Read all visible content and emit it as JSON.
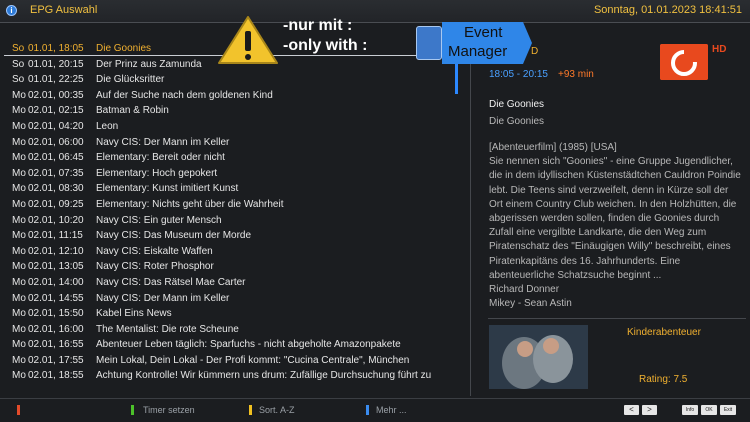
{
  "header": {
    "title": "EPG Auswahl",
    "datetime": "Sonntag, 01.01.2023  18:41:51"
  },
  "overlay": {
    "warning_line1": "-nur mit :",
    "warning_line2": "-only with :",
    "event_badge_1": "Event",
    "event_badge_2": "Manager"
  },
  "events": [
    {
      "day": "So",
      "datetime": "01.01, 18:05",
      "title": "Die Goonies"
    },
    {
      "day": "So",
      "datetime": "01.01, 20:15",
      "title": "Der Prinz aus Zamunda"
    },
    {
      "day": "So",
      "datetime": "01.01, 22:25",
      "title": "Die Glücksritter"
    },
    {
      "day": "Mo",
      "datetime": "02.01, 00:35",
      "title": "Auf der Suche nach dem goldenen Kind"
    },
    {
      "day": "Mo",
      "datetime": "02.01, 02:15",
      "title": "Batman & Robin"
    },
    {
      "day": "Mo",
      "datetime": "02.01, 04:20",
      "title": "Leon"
    },
    {
      "day": "Mo",
      "datetime": "02.01, 06:00",
      "title": "Navy CIS: Der Mann im Keller"
    },
    {
      "day": "Mo",
      "datetime": "02.01, 06:45",
      "title": "Elementary: Bereit oder nicht"
    },
    {
      "day": "Mo",
      "datetime": "02.01, 07:35",
      "title": "Elementary: Hoch gepokert"
    },
    {
      "day": "Mo",
      "datetime": "02.01, 08:30",
      "title": "Elementary: Kunst imitiert Kunst"
    },
    {
      "day": "Mo",
      "datetime": "02.01, 09:25",
      "title": "Elementary: Nichts geht über die Wahrheit"
    },
    {
      "day": "Mo",
      "datetime": "02.01, 10:20",
      "title": "Navy CIS: Ein guter Mensch"
    },
    {
      "day": "Mo",
      "datetime": "02.01, 11:15",
      "title": "Navy CIS: Das Museum der Morde"
    },
    {
      "day": "Mo",
      "datetime": "02.01, 12:10",
      "title": "Navy CIS: Eiskalte Waffen"
    },
    {
      "day": "Mo",
      "datetime": "02.01, 13:05",
      "title": "Navy CIS: Roter Phosphor"
    },
    {
      "day": "Mo",
      "datetime": "02.01, 14:00",
      "title": "Navy CIS: Das Rätsel Mae Carter"
    },
    {
      "day": "Mo",
      "datetime": "02.01, 14:55",
      "title": "Navy CIS: Der Mann im Keller"
    },
    {
      "day": "Mo",
      "datetime": "02.01, 15:50",
      "title": "Kabel Eins News"
    },
    {
      "day": "Mo",
      "datetime": "02.01, 16:00",
      "title": "The Mentalist: Die rote Scheune"
    },
    {
      "day": "Mo",
      "datetime": "02.01, 16:55",
      "title": "Abenteuer Leben täglich: Sparfuchs - nicht abgeholte Amazonpakete"
    },
    {
      "day": "Mo",
      "datetime": "02.01, 17:55",
      "title": "Mein Lokal, Dein Lokal - Der Profi kommt: \"Cucina Centrale\", München"
    },
    {
      "day": "Mo",
      "datetime": "02.01, 18:55",
      "title": "Achtung Kontrolle! Wir kümmern uns drum: Zufällige Durchsuchung führt zu"
    }
  ],
  "details": {
    "letter": "D",
    "time_range": "18:05 - 20:15",
    "duration": "+93 min",
    "channel_hd": "HD",
    "title": "Die Goonies",
    "subtitle": "Die Goonies",
    "meta": "[Abenteuerfilm]  (1985) [USA]",
    "description": "Sie nennen sich \"Goonies\" - eine Gruppe Jugendlicher, die in dem idyllischen Küstenstädtchen Cauldron Poindie lebt. Die Teens sind verzweifelt, denn in Kürze soll der Ort einem Country Club weichen. In den Holzhütten, die abgerissen werden sollen, finden die Goonies durch Zufall eine vergilbte Landkarte, die den Weg zum Piratenschatz des \"Einäugigen Willy\" beschreibt, eines Piratenkapitäns des 16. Jahrhunderts. Eine abenteuerliche Schatzsuche beginnt ...",
    "director": "Richard Donner",
    "cast": "Mikey - Sean Astin",
    "genre": "Kinderabenteuer",
    "rating": "Rating: 7.5"
  },
  "footer": {
    "green_label": "Timer setzen",
    "yellow_label": "Sort. A-Z",
    "blue_label": "Mehr ...",
    "prev_label": "<",
    "next_label": ">",
    "info_label": "Info",
    "ok_label": "OK",
    "exit_label": "Exit",
    "red_color": "#e34b2a",
    "green_color": "#4cc12a",
    "yellow_color": "#f0c020",
    "blue_color": "#3a8cf0"
  }
}
